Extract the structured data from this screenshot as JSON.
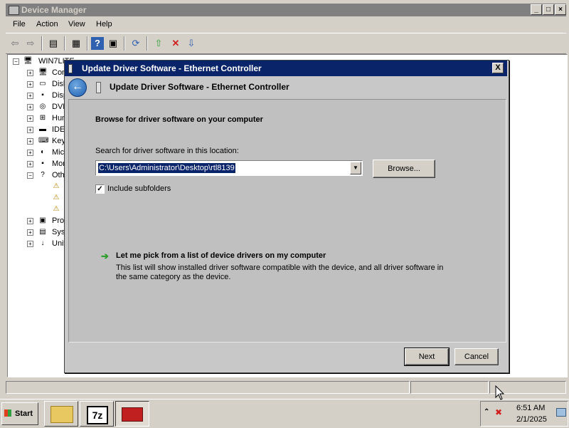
{
  "device_manager": {
    "title": "Device Manager",
    "menu": [
      "File",
      "Action",
      "View",
      "Help"
    ],
    "tree": {
      "root": "WIN7LITE",
      "items": [
        {
          "label": "Com",
          "icon": "computer-icon",
          "expanded": false
        },
        {
          "label": "Disk",
          "icon": "disk-icon",
          "expanded": false
        },
        {
          "label": "Disp",
          "icon": "monitor-icon",
          "expanded": false
        },
        {
          "label": "DVD",
          "icon": "dvd-icon",
          "expanded": false
        },
        {
          "label": "Hum",
          "icon": "hid-icon",
          "expanded": false
        },
        {
          "label": "IDE",
          "icon": "ide-icon",
          "expanded": false
        },
        {
          "label": "Key",
          "icon": "keyboard-icon",
          "expanded": false
        },
        {
          "label": "Mice",
          "icon": "mouse-icon",
          "expanded": false
        },
        {
          "label": "Mon",
          "icon": "monitor-icon",
          "expanded": false
        },
        {
          "label": "Oth",
          "icon": "unknown-device-icon",
          "expanded": true
        },
        {
          "label": "",
          "icon": "warning-device-icon",
          "child": true
        },
        {
          "label": "",
          "icon": "warning-device-icon",
          "child": true
        },
        {
          "label": "",
          "icon": "warning-device-icon",
          "child": true
        },
        {
          "label": "Proc",
          "icon": "processor-icon",
          "expanded": false
        },
        {
          "label": "Syst",
          "icon": "system-icon",
          "expanded": false
        },
        {
          "label": "Univ",
          "icon": "usb-icon",
          "expanded": false
        }
      ]
    }
  },
  "dialog": {
    "title": "Update Driver Software - Ethernet Controller",
    "header_title": "Update Driver Software - Ethernet Controller",
    "heading": "Browse for driver software on your computer",
    "search_label": "Search for driver software in this location:",
    "path_value": "C:\\Users\\Administrator\\Desktop\\rtl8139",
    "browse_label": "Browse...",
    "include_subfolders_label": "Include subfolders",
    "include_subfolders_checked": true,
    "pick_title": "Let me pick from a list of device drivers on my computer",
    "pick_desc_line1": "This list will show installed driver software compatible with the device, and all driver software in",
    "pick_desc_line2": "the same category as the device.",
    "next_label": "Next",
    "cancel_label": "Cancel",
    "close_label": "X"
  },
  "taskbar": {
    "start_label": "Start",
    "tasks": [
      {
        "name": "explorer-icon",
        "active": false
      },
      {
        "name": "7zip-icon",
        "label": "7z",
        "active": false
      },
      {
        "name": "toolbox-icon",
        "active": true
      }
    ],
    "time": "6:51 AM",
    "date": "2/1/2025"
  }
}
